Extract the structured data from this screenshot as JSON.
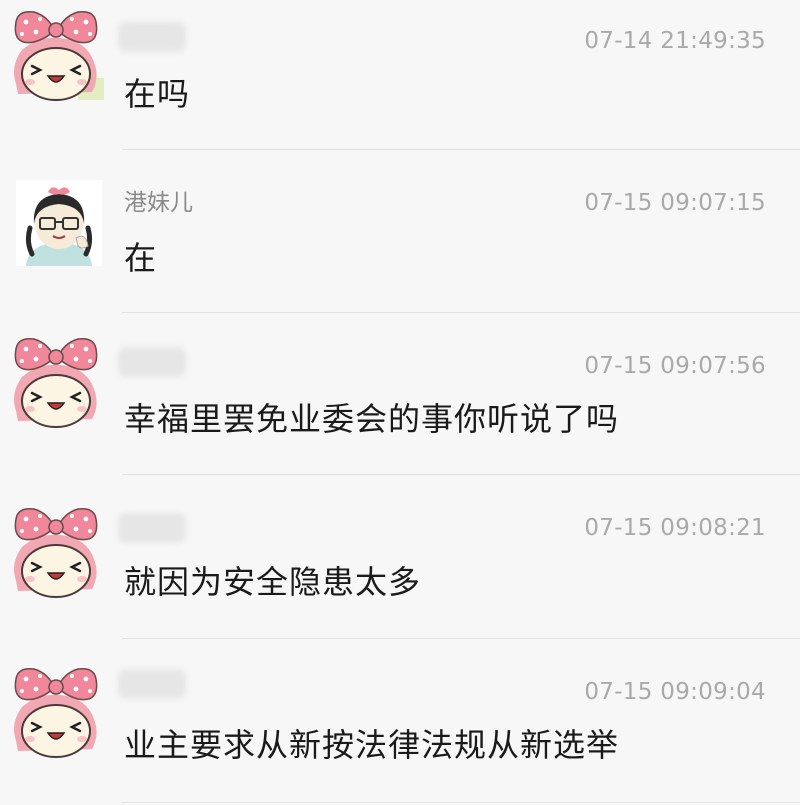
{
  "messages": [
    {
      "sender": "",
      "sender_redacted": true,
      "avatar": "pink-bow-girl-avatar",
      "time": "07-14 21:49:35",
      "text": "在吗"
    },
    {
      "sender": "港妹儿",
      "sender_redacted": false,
      "avatar": "glasses-girl-avatar",
      "time": "07-15 09:07:15",
      "text": "在"
    },
    {
      "sender": "",
      "sender_redacted": true,
      "avatar": "pink-bow-girl-avatar",
      "time": "07-15 09:07:56",
      "text": "幸福里罢免业委会的事你听说了吗"
    },
    {
      "sender": "",
      "sender_redacted": true,
      "avatar": "pink-bow-girl-avatar",
      "time": "07-15 09:08:21",
      "text": "就因为安全隐患太多"
    },
    {
      "sender": "",
      "sender_redacted": true,
      "avatar": "pink-bow-girl-avatar",
      "time": "07-15 09:09:04",
      "text": "业主要求从新按法律法规从新选举"
    }
  ],
  "colors": {
    "background": "#f7f7f7",
    "bow": "#f1879a",
    "timestamp": "#a9a9a9",
    "sender": "#8a8a8a",
    "message_text": "#1a1a1a"
  }
}
